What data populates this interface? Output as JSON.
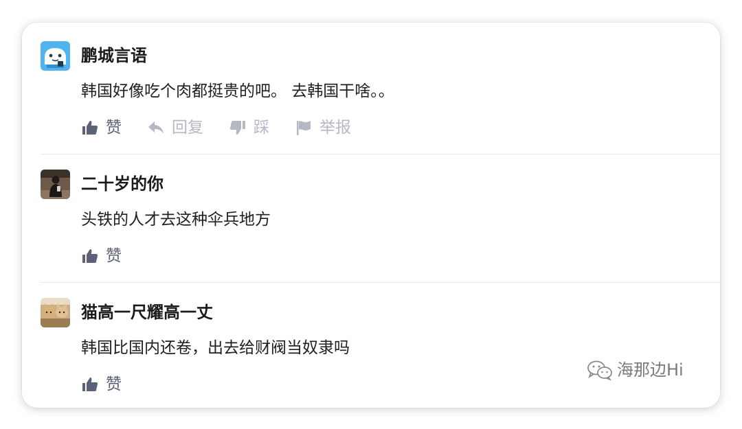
{
  "comments": [
    {
      "username": "鹏城言语",
      "avatar": "cartoon-avatar",
      "text": "韩国好像吃个肉都挺贵的吧。 去韩国干啥。。",
      "actions": {
        "like": "赞",
        "reply": "回复",
        "dislike": "踩",
        "report": "举报"
      }
    },
    {
      "username": "二十岁的你",
      "avatar": "photo-avatar-person",
      "text": "头铁的人才去这种伞兵地方",
      "actions": {
        "like": "赞"
      }
    },
    {
      "username": "猫高一尺耀高一丈",
      "avatar": "photo-avatar-cats",
      "text": "韩国比国内还卷，出去给财阀当奴隶吗",
      "actions": {
        "like": "赞"
      }
    }
  ],
  "watermark": {
    "icon": "wechat-icon",
    "text": "海那边Hi"
  },
  "colors": {
    "like": "#5c6278",
    "muted_action": "#b4b8c4",
    "text": "#1f1f1f",
    "divider": "#e9e9ee"
  }
}
